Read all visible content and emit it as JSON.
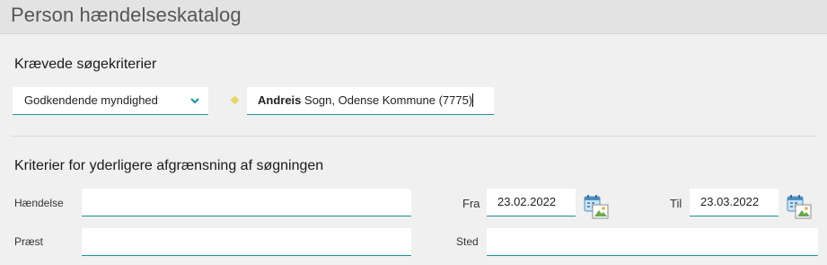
{
  "header": {
    "title": "Person hændelseskatalog"
  },
  "required": {
    "section_title": "Krævede søgekriterier",
    "authority_select": {
      "value": "Godkendende myndighed"
    },
    "authority_input": {
      "bold_prefix": "Andreis",
      "rest": " Sogn, Odense Kommune (7775)"
    }
  },
  "filters": {
    "section_title": "Kriterier for yderligere afgrænsning af søgningen",
    "event_label": "Hændelse",
    "event_value": "",
    "priest_label": "Præst",
    "priest_value": "",
    "from_label": "Fra",
    "from_date": "23.02.2022",
    "to_label": "Til",
    "to_date": "23.03.2022",
    "place_label": "Sted",
    "place_value": ""
  },
  "colors": {
    "accent": "#1e8fa0",
    "required_marker": "#e6d56a"
  },
  "icons": {
    "dropdown": "chevron-down-icon",
    "calendar": "calendar-icon"
  }
}
